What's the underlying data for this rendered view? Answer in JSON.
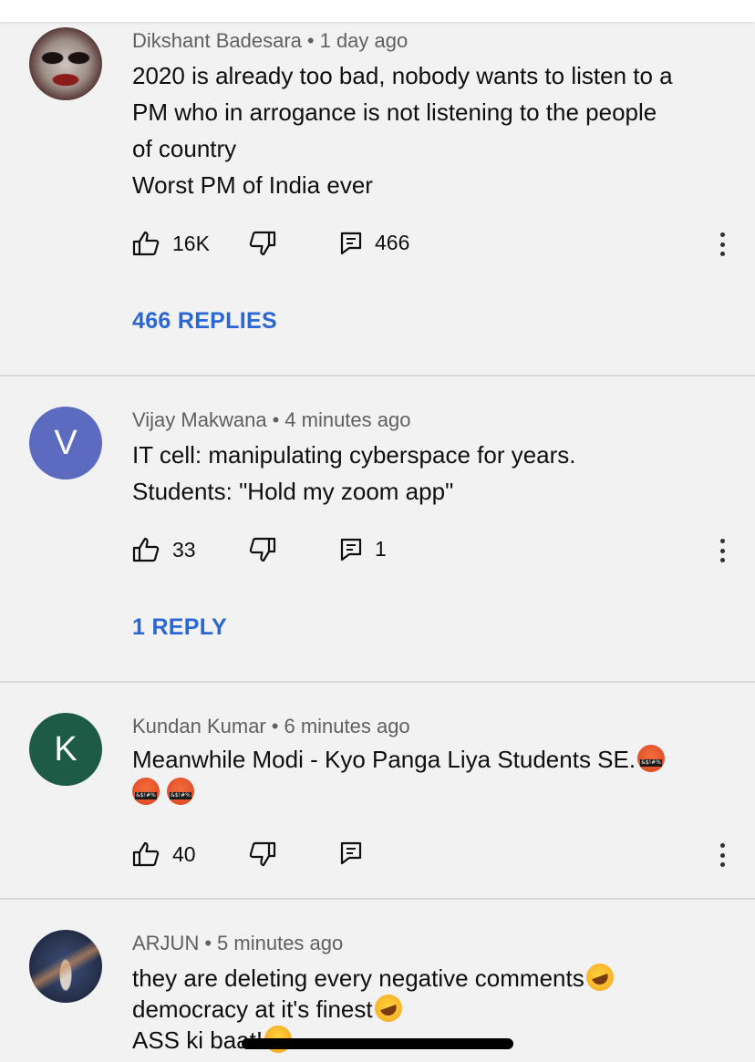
{
  "comments": [
    {
      "author": "Dikshant Badesara",
      "time": "1 day ago",
      "lines": [
        "2020 is already too bad, nobody wants to listen to a",
        "PM who in arrogance is not listening to the people",
        "of country",
        "Worst PM of India ever"
      ],
      "likes": "16K",
      "reply_count": "466",
      "replies_link": "466 REPLIES"
    },
    {
      "author": "Vijay Makwana",
      "time": "4 minutes ago",
      "avatar_letter": "V",
      "avatar_color": "#5c6bc0",
      "lines": [
        "IT cell: manipulating cyberspace for years.",
        "Students: \"Hold my zoom app\""
      ],
      "likes": "33",
      "reply_count": "1",
      "replies_link": "1 REPLY"
    },
    {
      "author": "Kundan Kumar",
      "time": "6 minutes ago",
      "avatar_letter": "K",
      "avatar_color": "#1e5b46",
      "lines": [
        "Meanwhile Modi - Kyo Panga Liya Students SE."
      ],
      "emojis": [
        "face-with-symbols-on-mouth",
        "face-with-symbols-on-mouth",
        "face-with-symbols-on-mouth"
      ],
      "likes": "40",
      "reply_count": ""
    },
    {
      "author": "ARJUN",
      "time": "5 minutes ago",
      "lines": [
        "they are deleting every negative comments",
        "democracy at it's finest",
        "ASS ki baat!"
      ],
      "emojis": [
        "rolling-on-the-floor-laughing",
        "rolling-on-the-floor-laughing",
        "confounded-face"
      ]
    }
  ],
  "icons": {
    "like": "thumbs-up-icon",
    "dislike": "thumbs-down-icon",
    "reply": "reply-comment-icon",
    "more": "more-vertical-icon"
  },
  "colors": {
    "background": "#f2f2f2",
    "link": "#2a67d5",
    "meta": "#606060"
  }
}
